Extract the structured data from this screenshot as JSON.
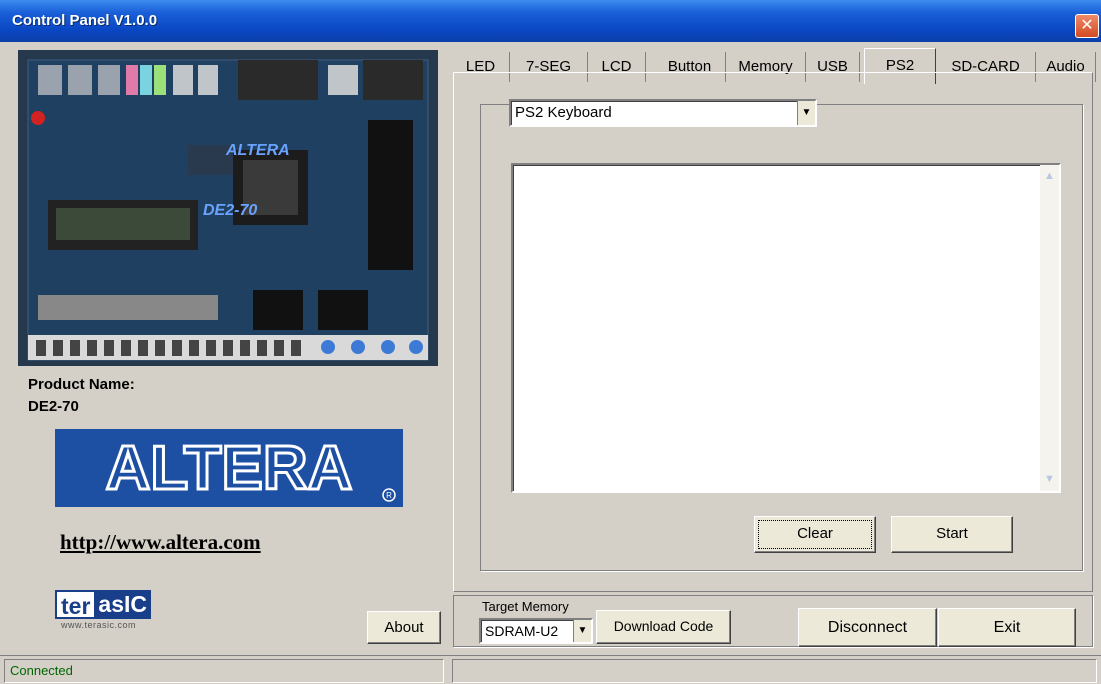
{
  "window": {
    "title": "Control Panel V1.0.0"
  },
  "left": {
    "product_label": "Product Name:",
    "product_name": "DE2-70",
    "altera_logo": "ALTERA",
    "altera_link": "http://www.altera.com",
    "terasic_ter": "ter",
    "terasic_asic": "asIC",
    "terasic_url": "www.terasic.com",
    "about_label": "About"
  },
  "tabs": [
    "LED",
    "7-SEG",
    "LCD",
    "Button",
    "Memory",
    "USB",
    "PS2",
    "SD-CARD",
    "Audio"
  ],
  "active_tab": "PS2",
  "ps2": {
    "device_select": "PS2 Keyboard",
    "clear_label": "Clear",
    "start_label": "Start"
  },
  "memory": {
    "label": "Target Memory",
    "select": "SDRAM-U2",
    "download_label": "Download Code",
    "disconnect_label": "Disconnect",
    "exit_label": "Exit"
  },
  "status": {
    "text": "Connected"
  }
}
